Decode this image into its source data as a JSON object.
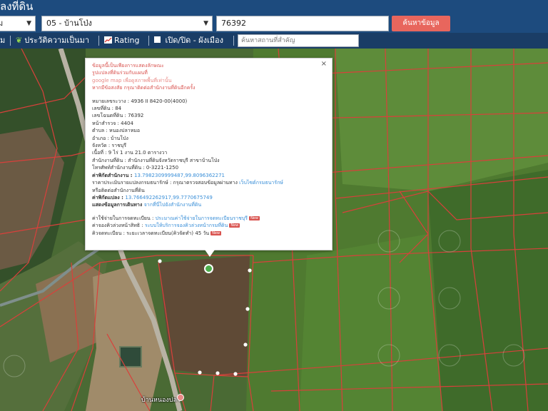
{
  "header": {
    "title": "ลงที่ดิน",
    "district_value": "ม",
    "subdistrict_value": "05 - บ้านโป่ง",
    "parcel_value": "76392",
    "search_label": "ค้นหาข้อมูล"
  },
  "toolbar": {
    "item0": "ม",
    "history_label": "ประวัติความเป็นมา",
    "rating_label": "Rating",
    "toggle_layer_label": "เปิด/ปิด - ผังเมือง",
    "place_search_placeholder": "ค้นหาสถานที่สำคัญ"
  },
  "popup": {
    "warning_1": "ข้อมูลนี้เป็นเพียงการแสดงลักษณะ",
    "warning_2": "รูปแปลงที่ดินร่วมกับแผนที่",
    "warning_3": "google map เพื่อดูสภาพพื้นที่เท่านั้น",
    "warning_4": "หากมีข้อสงสัย กรุณาติดต่อสำนักงานที่ดินอีกครั้ง",
    "map_sheet": "หมายเลขระวาง : 4936 II 8420-00(4000)",
    "land_no": "เลขที่ดิน : 84",
    "deed_no": "เลขโฉนดที่ดิน : 76392",
    "survey_page": "หน้าสำรวจ : 4404",
    "subdistrict": "ตำบล : หนองปลาหมอ",
    "district": "อำเภอ : บ้านโป่ง",
    "province": "จังหวัด : ราชบุรี",
    "area": "เนื้อที่ : 9 ไร่ 1 งาน 21.0 ตารางวา",
    "land_office": "สำนักงานที่ดิน : สำนักงานที่ดินจังหวัดราชบุรี สาขาบ้านโป่ง",
    "office_phone": "โทรศัพท์สำนักงานที่ดิน : 0-3221-1250",
    "office_coord_label": "ค่าพิกัดสำนักงาน : ",
    "office_coord_value": "13.7982309999487,99.8096362271",
    "price_label": "ราคาประเมินรายแปลงกรมธนารักษ์ : กรุณาตรวจสอบข้อมูลผ่านทาง ",
    "price_link": "เว็บไซต์กรมธนารักษ์",
    "contact_office": "หรือติดต่อสำนักงานที่ดิน",
    "parcel_coord_label": "ค่าพิกัดแปลง : ",
    "parcel_coord_value": "13.766492262917,99.7770675749",
    "route_label": "แสดงข้อมูลการเดินทาง ",
    "route_link": "จากที่นี่ไปยังสำนักงานที่ดิน",
    "reg_fee_label": "ค่าใช้จ่ายในการจดทะเบียน : ",
    "reg_fee_link": "ประมาณค่าใช้จ่ายในการจดทะเบียนราชบุรี",
    "reg_booking_label": "ค่าจองคิวล่วงหน้าสิทธิ : ",
    "reg_booking_link": "ระบบให้บริการจองคิวล่วงหน้ากรมที่ดิน",
    "reg_queue": "คิวจดทะเบียน : ระยะเวลาจดทะเบียน(คิวจัดทำ) 45 วัน",
    "new_badge": "New",
    "close_label": "×"
  },
  "map": {
    "village_label": "บ้านหนองปลา",
    "marker_icon": "location-pin-icon"
  },
  "colors": {
    "header_bg": "#1d4b7e",
    "toolbar_bg": "#1a3d66",
    "search_button": "#e8665d",
    "parcel_line": "#d9403b",
    "link": "#3a8fd8",
    "warning": "#d9534f"
  }
}
